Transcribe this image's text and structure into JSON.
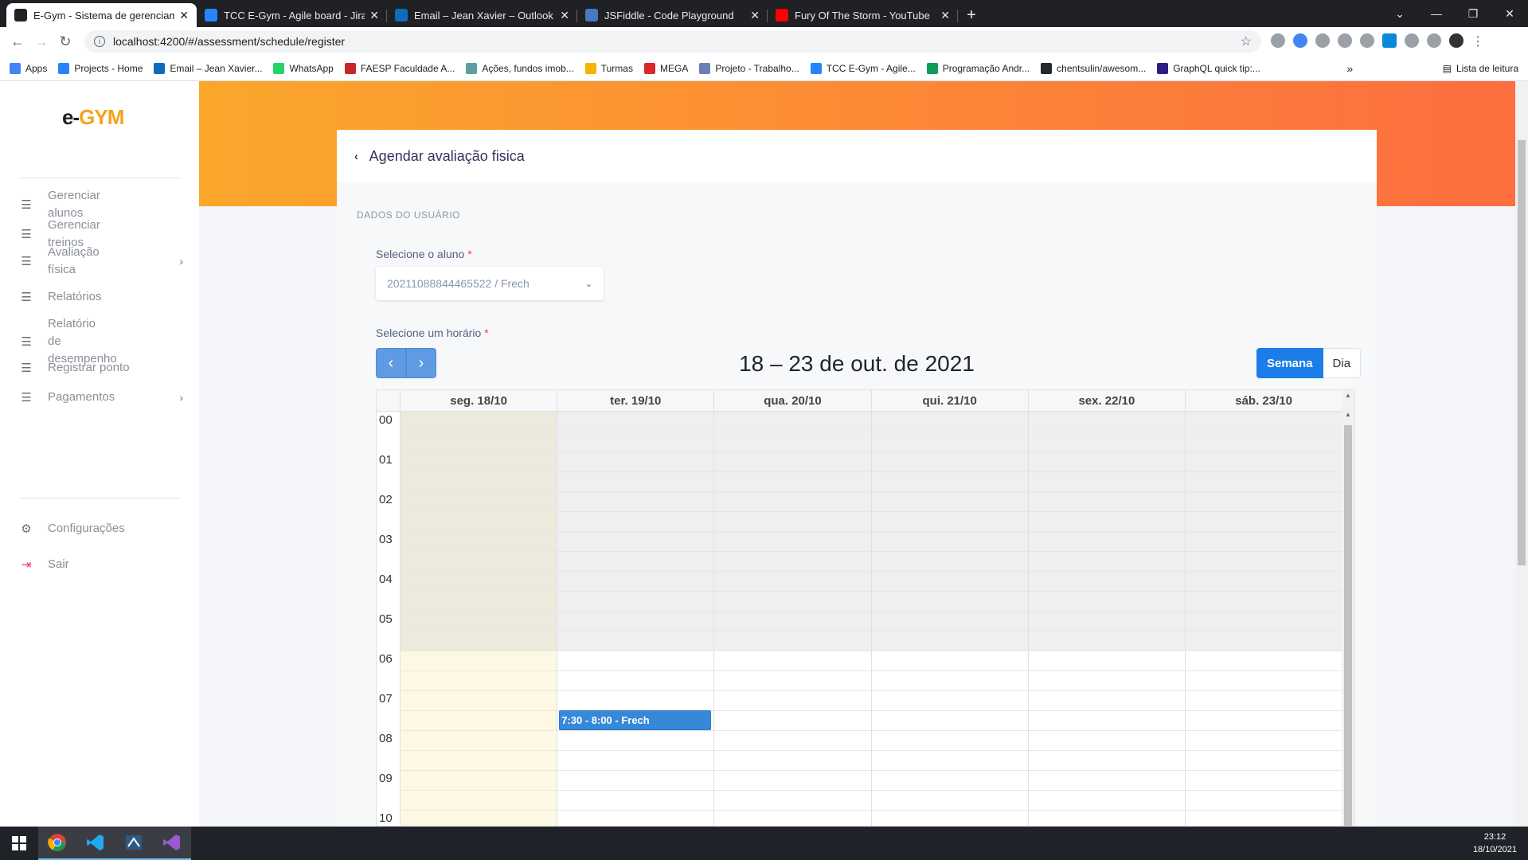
{
  "browser": {
    "tabs": [
      {
        "label": "E-Gym - Sistema de gerenciamento",
        "favicon_color": "#222222",
        "active": true
      },
      {
        "label": "TCC E-Gym - Agile board - Jira",
        "favicon_color": "#2684ff",
        "active": false
      },
      {
        "label": "Email – Jean Xavier – Outlook",
        "favicon_color": "#0f6cbd",
        "active": false
      },
      {
        "label": "JSFiddle - Code Playground",
        "favicon_color": "#4679bd",
        "active": false
      },
      {
        "label": "Fury Of The Storm - YouTube",
        "favicon_color": "#ff0000",
        "active": false
      }
    ],
    "url": "localhost:4200/#/assessment/schedule/register",
    "bookmarks": [
      {
        "label": "Apps",
        "color": "#4285f4"
      },
      {
        "label": "Projects - Home",
        "color": "#2684ff"
      },
      {
        "label": "Email – Jean Xavier...",
        "color": "#0f6cbd"
      },
      {
        "label": "WhatsApp",
        "color": "#25d366"
      },
      {
        "label": "FAESP Faculdade A...",
        "color": "#c62828"
      },
      {
        "label": "Ações, fundos imob...",
        "color": "#5f9ea0"
      },
      {
        "label": "Turmas",
        "color": "#f4b400"
      },
      {
        "label": "MEGA",
        "color": "#d9272e"
      },
      {
        "label": "Projeto - Trabalho...",
        "color": "#6b7fb5"
      },
      {
        "label": "TCC E-Gym - Agile...",
        "color": "#2684ff"
      },
      {
        "label": "Programação Andr...",
        "color": "#0f9d58"
      },
      {
        "label": "chentsulin/awesom...",
        "color": "#24292e"
      },
      {
        "label": "GraphQL quick tip:...",
        "color": "#311c87"
      }
    ],
    "reading_list": "Lista de leitura"
  },
  "sidebar": {
    "logo": {
      "prefix": "e-",
      "suffix": "GYM"
    },
    "items": [
      {
        "label": "Gerenciar alunos",
        "icon": "list-icon",
        "chevron": false
      },
      {
        "label": "Gerenciar treinos",
        "icon": "list-icon",
        "chevron": false
      },
      {
        "label": "Avaliação física",
        "icon": "list-icon",
        "chevron": true
      },
      {
        "label": "Relatórios",
        "icon": "list-icon",
        "chevron": false
      },
      {
        "label": "Relatório de desempenho",
        "icon": "list-icon",
        "chevron": false
      },
      {
        "label": "Registrar ponto",
        "icon": "list-icon",
        "chevron": false
      },
      {
        "label": "Pagamentos",
        "icon": "list-icon",
        "chevron": true
      }
    ],
    "settings": "Configurações",
    "logout": "Sair",
    "logout_color": "#f5365c"
  },
  "page": {
    "title": "Agendar avaliação fisica",
    "section": "DADOS DO USUÁRIO",
    "student_label": "Selecione o aluno",
    "student_value": "20211088844465522 / Frech",
    "time_label": "Selecione um horário",
    "required_mark": "*"
  },
  "calendar": {
    "title": "18 – 23 de out. de 2021",
    "view_week": "Semana",
    "view_day": "Dia",
    "days": [
      "seg. 18/10",
      "ter. 19/10",
      "qua. 20/10",
      "qui. 21/10",
      "sex. 22/10",
      "sáb. 23/10"
    ],
    "hours": [
      "00",
      "01",
      "02",
      "03",
      "04",
      "05",
      "06",
      "07",
      "08",
      "09",
      "10"
    ],
    "today_index": 0,
    "closed_until_hour": 6,
    "event": {
      "label": "7:30 - 8:00 - Frech",
      "day_index": 1,
      "start_hour": 7.5,
      "end_hour": 8.0,
      "color": "#3788d8"
    }
  },
  "taskbar": {
    "time": "23:12",
    "date": "18/10/2021"
  }
}
